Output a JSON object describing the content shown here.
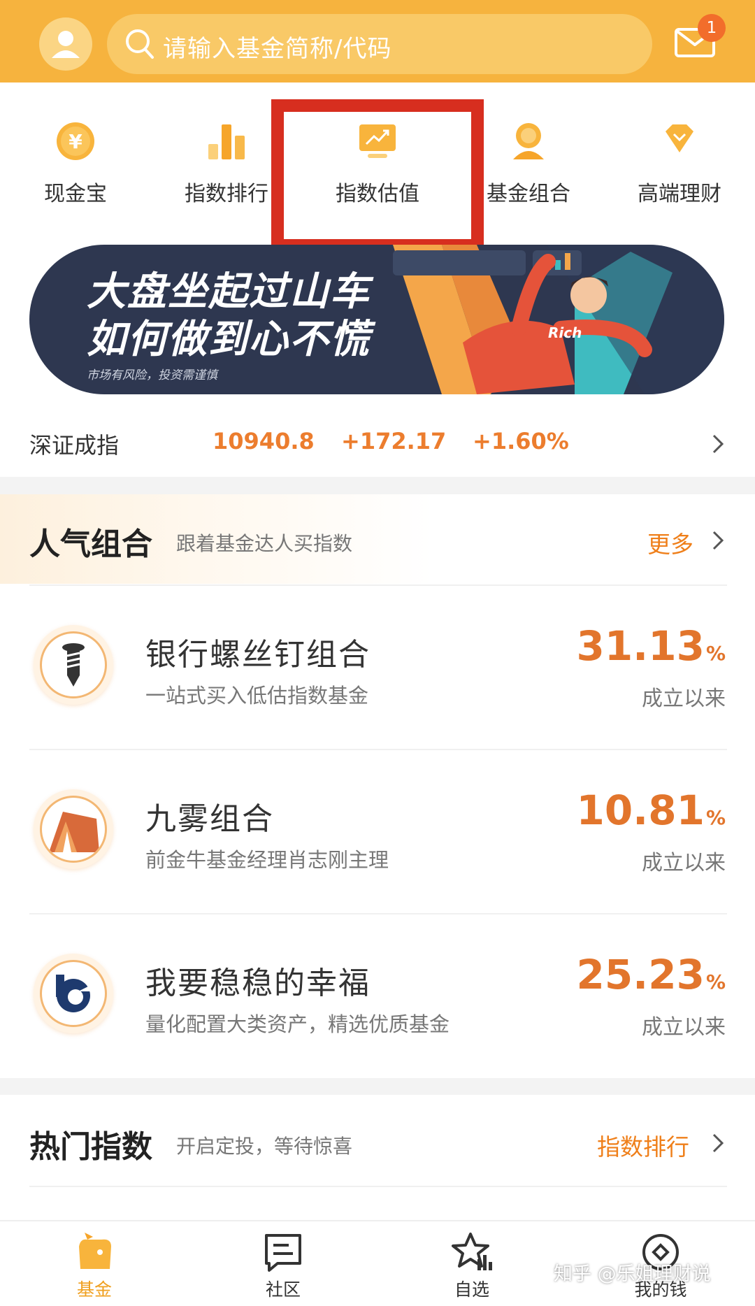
{
  "header": {
    "search_placeholder": "请输入基金简称/代码",
    "mail_badge": "1",
    "colors": {
      "header_bg": "#f6b33e",
      "search_bg": "#f9c967",
      "badge": "#f26d2b"
    }
  },
  "quick_nav": {
    "items": [
      {
        "label": "现金宝",
        "icon": "yen-coin-icon"
      },
      {
        "label": "指数排行",
        "icon": "bar-chart-icon"
      },
      {
        "label": "指数估值",
        "icon": "trend-monitor-icon"
      },
      {
        "label": "基金组合",
        "icon": "medal-icon"
      },
      {
        "label": "高端理财",
        "icon": "diamond-icon"
      }
    ],
    "highlighted_item": "指数估值",
    "highlight_color": "#d72e1f"
  },
  "banner": {
    "line1": "大盘坐起过山车",
    "line2": "如何做到心不慌",
    "disclaimer": "市场有风险，投资需谨慎",
    "shirt_text": "Rich"
  },
  "ticker": {
    "name": "深证成指",
    "value": "10940.8",
    "change": "+172.17",
    "change_pct": "+1.60%",
    "color": "#ec7d2e"
  },
  "popular": {
    "title": "人气组合",
    "subtitle": "跟着基金达人买指数",
    "more": "更多",
    "items": [
      {
        "name": "银行螺丝钉组合",
        "desc": "一站式买入低估指数基金",
        "rate": "31.13",
        "unit": "%",
        "since": "成立以来",
        "icon": "screw-icon"
      },
      {
        "name": "九雾组合",
        "desc": "前金牛基金经理肖志刚主理",
        "rate": "10.81",
        "unit": "%",
        "since": "成立以来",
        "icon": "mountain-icon"
      },
      {
        "name": "我要稳稳的幸福",
        "desc": "量化配置大类资产，精选优质基金",
        "rate": "25.23",
        "unit": "%",
        "since": "成立以来",
        "icon": "b-logo-icon"
      }
    ],
    "accent": "#e2752c"
  },
  "hot_index": {
    "title": "热门指数",
    "subtitle": "开启定投，等待惊喜",
    "more": "指数排行"
  },
  "tabbar": {
    "items": [
      {
        "label": "基金",
        "icon": "fund-bag-icon",
        "active": true
      },
      {
        "label": "社区",
        "icon": "community-icon",
        "active": false
      },
      {
        "label": "自选",
        "icon": "star-chart-icon",
        "active": false
      },
      {
        "label": "我的钱",
        "icon": "coin-circle-icon",
        "active": false
      }
    ]
  },
  "watermark": "知乎 @乐姐理财说"
}
